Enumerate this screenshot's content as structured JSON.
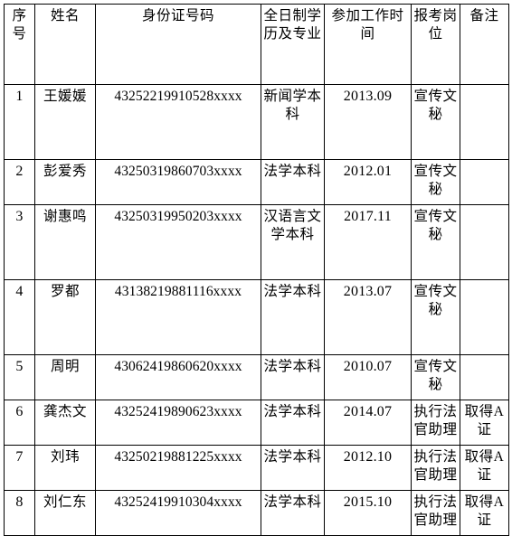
{
  "table": {
    "columns": [
      {
        "key": "seq",
        "label": "序号",
        "class": "c-seq"
      },
      {
        "key": "name",
        "label": "姓名",
        "class": "c-name"
      },
      {
        "key": "id",
        "label": "身份证号码",
        "class": "c-id"
      },
      {
        "key": "edu",
        "label": "全日制学历及专业",
        "class": "c-edu"
      },
      {
        "key": "date",
        "label": "参加工作时间",
        "class": "c-date"
      },
      {
        "key": "post",
        "label": "报考岗位",
        "class": "c-post"
      },
      {
        "key": "note",
        "label": "备注",
        "class": "c-note"
      }
    ],
    "headers": {
      "seq": "序号",
      "name": "姓名",
      "id": "身份证号码",
      "edu": "全日制学历及专业",
      "date": "参加工作时间",
      "post": "报考岗位",
      "note": "备注"
    },
    "rows": [
      {
        "seq": "1",
        "name": "王媛媛",
        "id": "43252219910528xxxx",
        "edu": "新闻学本科",
        "date": "2013.09",
        "post": "宣传文秘",
        "note": ""
      },
      {
        "seq": "2",
        "name": "彭爱秀",
        "id": "43250319860703xxxx",
        "edu": "法学本科",
        "date": "2012.01",
        "post": "宣传文秘",
        "note": ""
      },
      {
        "seq": "3",
        "name": "谢惠鸣",
        "id": "43250319950203xxxx",
        "edu": "汉语言文学本科",
        "date": "2017.11",
        "post": "宣传文秘",
        "note": ""
      },
      {
        "seq": "4",
        "name": "罗都",
        "id": "43138219881116xxxx",
        "edu": "法学本科",
        "date": "2013.07",
        "post": "宣传文秘",
        "note": ""
      },
      {
        "seq": "5",
        "name": "周明",
        "id": "43062419860620xxxx",
        "edu": "法学本科",
        "date": "2010.07",
        "post": "宣传文秘",
        "note": ""
      },
      {
        "seq": "6",
        "name": "龚杰文",
        "id": "43252419890623xxxx",
        "edu": "法学本科",
        "date": "2014.07",
        "post": "执行法官助理",
        "note": "取得A证"
      },
      {
        "seq": "7",
        "name": "刘玮",
        "id": "43250219881225xxxx",
        "edu": "法学本科",
        "date": "2012.10",
        "post": "执行法官助理",
        "note": "取得A证"
      },
      {
        "seq": "8",
        "name": "刘仁东",
        "id": "43252419910304xxxx",
        "edu": "法学本科",
        "date": "2015.10",
        "post": "执行法官助理",
        "note": "取得A证"
      }
    ],
    "tall_rows": [
      0,
      2,
      3
    ]
  }
}
